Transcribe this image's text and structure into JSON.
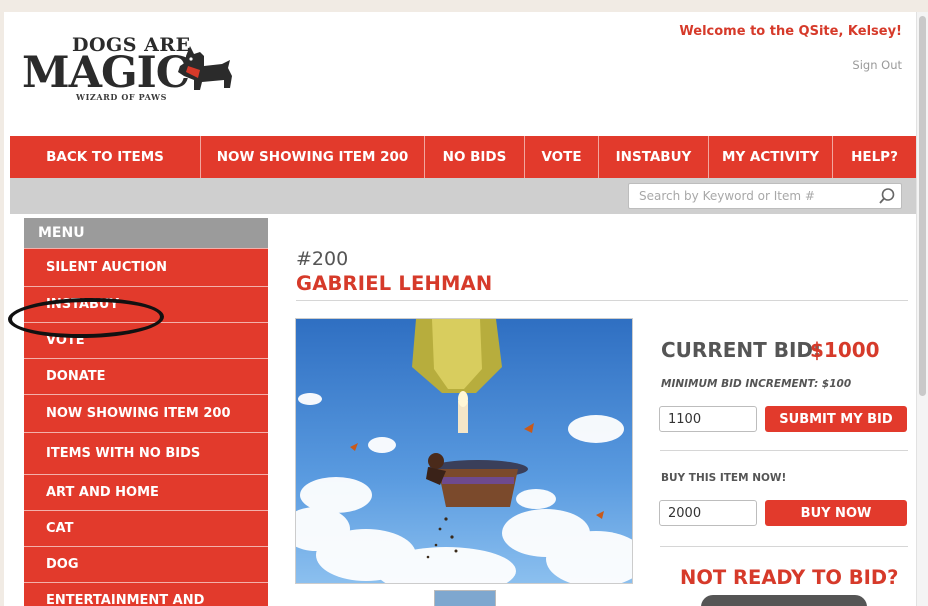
{
  "header": {
    "logo_top": "DOGS ARE",
    "logo_main": "MAGIC",
    "logo_sub": "WIZARD OF PAWS",
    "welcome": "Welcome to the QSite, Kelsey!",
    "sign_out": "Sign Out"
  },
  "nav": {
    "items": [
      "BACK TO ITEMS",
      "NOW SHOWING ITEM 200",
      "NO BIDS",
      "VOTE",
      "INSTABUY",
      "MY ACTIVITY",
      "HELP?"
    ]
  },
  "search": {
    "placeholder": "Search by Keyword or Item #"
  },
  "menu": {
    "header": "MENU",
    "items": [
      "SILENT AUCTION",
      "INSTABUY",
      "VOTE",
      "DONATE",
      "NOW SHOWING ITEM 200",
      "ITEMS WITH NO BIDS",
      "ART AND HOME",
      "CAT",
      "DOG",
      "ENTERTAINMENT AND"
    ]
  },
  "item": {
    "number": "#200",
    "title": "GABRIEL LEHMAN"
  },
  "bid": {
    "current_label": "CURRENT BID:",
    "current_value": "$1000",
    "min_increment": "MINIMUM BID INCREMENT: $100",
    "bid_value": "1100",
    "submit_label": "SUBMIT MY BID",
    "buy_label": "BUY THIS ITEM NOW!",
    "buy_value": "2000",
    "buy_button": "BUY NOW",
    "not_ready": "NOT READY TO BID?"
  },
  "colors": {
    "brand_red": "#e23a2c",
    "text_red": "#d63a2a",
    "menu_header_gray": "#9b9b9b"
  }
}
